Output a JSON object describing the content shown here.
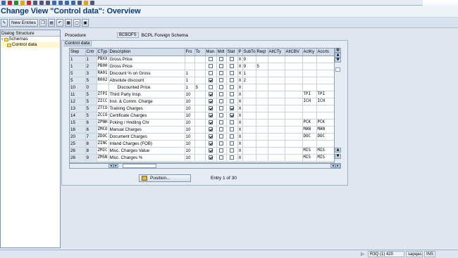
{
  "window": {
    "title": "Change View \"Control data\": Overview"
  },
  "toolbar": {
    "new_entries": "New Entries"
  },
  "nav": {
    "header": "Dialog Structure",
    "items": [
      {
        "label": "Schemas"
      },
      {
        "label": "Control data"
      }
    ]
  },
  "procedure": {
    "label": "Procedure",
    "code": "BCBOFS",
    "desc": "BCPL Foreign Schema"
  },
  "group_title": "Control data",
  "table": {
    "columns": [
      "Step",
      "Cntr",
      "CTyp",
      "Description",
      "Fro",
      "To",
      "Man.",
      "Mdt",
      "Stat",
      "P",
      "SubTo",
      "Reqt",
      "AltCTy",
      "AltCBV",
      "ActKy",
      "Accrls"
    ],
    "rows": [
      {
        "step": "1",
        "cntr": "1",
        "ctyp": "PBXX",
        "desc": "Gross Price",
        "fro": "",
        "to": "",
        "man": false,
        "mdt": false,
        "stat": false,
        "p": "X",
        "subto": "9",
        "reqt": "",
        "altcty": "",
        "altcbv": "",
        "actky": "",
        "accrls": ""
      },
      {
        "step": "1",
        "cntr": "2",
        "ctyp": "PB00",
        "desc": "Gross Price",
        "fro": "",
        "to": "",
        "man": false,
        "mdt": false,
        "stat": false,
        "p": "X",
        "subto": "9",
        "reqt": "5",
        "altcty": "",
        "altcbv": "",
        "actky": "",
        "accrls": ""
      },
      {
        "step": "5",
        "cntr": "3",
        "ctyp": "RA01",
        "desc": "Discount % on Gross",
        "fro": "1",
        "to": "",
        "man": false,
        "mdt": false,
        "stat": false,
        "p": "X",
        "subto": "1",
        "reqt": "",
        "altcty": "",
        "altcbv": "",
        "actky": "",
        "accrls": ""
      },
      {
        "step": "5",
        "cntr": "5",
        "ctyp": "R002",
        "desc": "Absolute discount",
        "fro": "1",
        "to": "",
        "man": true,
        "mdt": false,
        "stat": false,
        "p": "X",
        "subto": "2",
        "reqt": "",
        "altcty": "",
        "altcbv": "",
        "actky": "",
        "accrls": ""
      },
      {
        "step": "10",
        "cntr": "0",
        "ctyp": "",
        "desc": "Discounted Price",
        "fro": "1",
        "to": "5",
        "man": false,
        "mdt": false,
        "stat": false,
        "p": "X",
        "subto": "",
        "reqt": "",
        "altcty": "",
        "altcbv": "",
        "actky": "",
        "accrls": ""
      },
      {
        "step": "11",
        "cntr": "5",
        "ctyp": "ZTPI",
        "desc": "Third Party Insp.",
        "fro": "10",
        "to": "",
        "man": true,
        "mdt": false,
        "stat": false,
        "p": "X",
        "subto": "",
        "reqt": "",
        "altcty": "",
        "altcbv": "",
        "actky": "TPI",
        "accrls": "TPI"
      },
      {
        "step": "12",
        "cntr": "5",
        "ctyp": "ZICC",
        "desc": "Inst. & Comm. Charge",
        "fro": "10",
        "to": "",
        "man": true,
        "mdt": false,
        "stat": false,
        "p": "X",
        "subto": "",
        "reqt": "",
        "altcty": "",
        "altcbv": "",
        "actky": "ICH",
        "accrls": "ICH"
      },
      {
        "step": "13",
        "cntr": "5",
        "ctyp": "ZTCO",
        "desc": "Training Charges",
        "fro": "10",
        "to": "",
        "man": true,
        "mdt": false,
        "stat": true,
        "p": "X",
        "subto": "",
        "reqt": "",
        "altcty": "",
        "altcbv": "",
        "actky": "",
        "accrls": ""
      },
      {
        "step": "14",
        "cntr": "5",
        "ctyp": "ZCCO",
        "desc": "Certificate Charges",
        "fro": "10",
        "to": "",
        "man": true,
        "mdt": false,
        "stat": true,
        "p": "X",
        "subto": "",
        "reqt": "",
        "altcty": "",
        "altcbv": "",
        "actky": "",
        "accrls": ""
      },
      {
        "step": "15",
        "cntr": "6",
        "ctyp": "ZPNH",
        "desc": "Pcking / Hndling Chr",
        "fro": "10",
        "to": "",
        "man": true,
        "mdt": false,
        "stat": false,
        "p": "X",
        "subto": "",
        "reqt": "",
        "altcty": "",
        "altcbv": "",
        "actky": "PCK",
        "accrls": "PCK"
      },
      {
        "step": "16",
        "cntr": "6",
        "ctyp": "ZMCO",
        "desc": "Manual Charges",
        "fro": "10",
        "to": "",
        "man": true,
        "mdt": false,
        "stat": false,
        "p": "X",
        "subto": "",
        "reqt": "",
        "altcty": "",
        "altcbv": "",
        "actky": "MAN",
        "accrls": "MAN"
      },
      {
        "step": "20",
        "cntr": "7",
        "ctyp": "ZDOC",
        "desc": "Document Charges",
        "fro": "10",
        "to": "",
        "man": true,
        "mdt": false,
        "stat": false,
        "p": "X",
        "subto": "",
        "reqt": "",
        "altcty": "",
        "altcbv": "",
        "actky": "DOC",
        "accrls": "DOC"
      },
      {
        "step": "25",
        "cntr": "8",
        "ctyp": "ZINC",
        "desc": "Inland Charges (FOB)",
        "fro": "10",
        "to": "",
        "man": true,
        "mdt": false,
        "stat": false,
        "p": "X",
        "subto": "",
        "reqt": "",
        "altcty": "",
        "altcbv": "",
        "actky": "",
        "accrls": ""
      },
      {
        "step": "26",
        "cntr": "8",
        "ctyp": "ZMIC",
        "desc": "Misc. Charges Value",
        "fro": "10",
        "to": "",
        "man": true,
        "mdt": false,
        "stat": false,
        "p": "X",
        "subto": "",
        "reqt": "",
        "altcty": "",
        "altcbv": "",
        "actky": "MIS",
        "accrls": "MIS"
      },
      {
        "step": "26",
        "cntr": "9",
        "ctyp": "ZMSN",
        "desc": "Misc. Charges %",
        "fro": "10",
        "to": "",
        "man": true,
        "mdt": false,
        "stat": false,
        "p": "X",
        "subto": "",
        "reqt": "",
        "altcty": "",
        "altcbv": "",
        "actky": "MIS",
        "accrls": "MIS"
      }
    ]
  },
  "position_button": "Position...",
  "entry_text": "Entry 1 of 30",
  "status": {
    "system": "R3Q (1) 420",
    "host": "sapqas",
    "mode": "INS"
  },
  "colors": {
    "title": "#0a3b7a",
    "accent": "#7f96b2"
  }
}
